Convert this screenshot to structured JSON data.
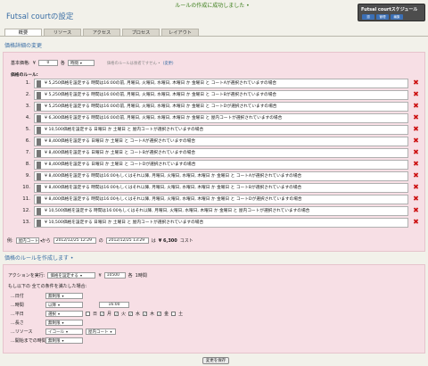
{
  "flash": "ルールの作成に成功しました •",
  "page_title": "Futsal courtの設定",
  "schedule": {
    "title": "Futsal courtスケジュール",
    "buttons": [
      {
        "label": "週",
        "color": "#3b6fb5"
      },
      {
        "label": "管理",
        "color": "#3b6fb5"
      },
      {
        "label": "編集",
        "color": "#3b6fb5"
      }
    ]
  },
  "tabs": [
    "概要",
    "リソース",
    "アクセス",
    "プロセス",
    "レイアウト"
  ],
  "pricing": {
    "section_title": "価格詳細の変更",
    "base_label": "基本価格:",
    "base_currency": "¥",
    "base_value": "0",
    "per_label": "各",
    "unit": "時間",
    "note": "価格のルールは後者ですせん • ",
    "note_link": "(変更)",
    "rules_label": "価格のルール:",
    "rules": [
      {
        "num": "1.",
        "text": "¥ 5,250価格を設定する 時間は16:00の前, 月曜日, 火曜日, 水曜日, 木曜日 か 金曜日 と コートAが選択されていますの場合"
      },
      {
        "num": "2.",
        "text": "¥ 5,250価格を設定する 時間は16:00の前, 月曜日, 火曜日, 水曜日, 木曜日 か 金曜日 と コートBが選択されていますの場合"
      },
      {
        "num": "3.",
        "text": "¥ 5,250価格を設定する 時間は16:00の前, 月曜日, 火曜日, 水曜日, 木曜日 か 金曜日 と コートDが選択されていますの場合"
      },
      {
        "num": "4.",
        "text": "¥ 6,300価格を設定する 時間は16:00の前, 月曜日, 火曜日, 水曜日, 木曜日 か 金曜日 と 屋内コートが選択されていますの場合"
      },
      {
        "num": "5.",
        "text": "¥ 10,500価格を設定する 日曜日 か 土曜日 と 屋内コートが選択されていますの場合"
      },
      {
        "num": "6.",
        "text": "¥ 8,400価格を設定する 日曜日 か 土曜日 と コートAが選択されていますの場合"
      },
      {
        "num": "7.",
        "text": "¥ 8,400価格を設定する 日曜日 か 土曜日 と コートBが選択されていますの場合"
      },
      {
        "num": "8.",
        "text": "¥ 8,400価格を設定する 日曜日 か 土曜日 と コートDが選択されていますの場合"
      },
      {
        "num": "9.",
        "text": "¥ 8,400価格を設定する 時間は16:00もしくはそれ以降, 月曜日, 火曜日, 水曜日, 木曜日 か 金曜日 と コートAが選択されていますの場合"
      },
      {
        "num": "10.",
        "text": "¥ 8,400価格を設定する 時間は16:00もしくはそれ以降, 月曜日, 火曜日, 水曜日, 木曜日 か 金曜日 と コートBが選択されていますの場合"
      },
      {
        "num": "11.",
        "text": "¥ 8,400価格を設定する 時間は16:00もしくはそれ以降, 月曜日, 火曜日, 水曜日, 木曜日 か 金曜日 と コートDが選択されていますの場合"
      },
      {
        "num": "12.",
        "text": "¥ 10,500価格を設定する 時間は16:00もしくはそれ以降, 月曜日, 火曜日, 水曜日, 木曜日 か 金曜日 と 屋内コートが選択されていますの場合"
      },
      {
        "num": "13.",
        "text": "¥ 10,500価格を設定する 日曜日 か 土曜日 と 屋内コートが選択されていますの場合"
      }
    ],
    "test": {
      "label": "例:",
      "resource": "屋内コート",
      "from": "から",
      "start": "2012/12/25 12:29",
      "to": "の",
      "end": "2012/12/25 13:29",
      "result_prefix": "は",
      "result": "¥ 6,300",
      "result_suffix": "コスト"
    }
  },
  "create": {
    "section_title": "価格のルールを作成します •",
    "action_label": "アクションを実行:",
    "action": "価格を設定する",
    "currency": "¥",
    "amount": "10500",
    "per": "各",
    "per_unit": "1時間",
    "cond_label": "もし以下の 全ての条件を満たした場合:",
    "rows": [
      {
        "label": "...日付",
        "op": "無制限"
      },
      {
        "label": "...時間",
        "op": "以降",
        "value": "16:00"
      },
      {
        "label": "...平日",
        "op": "選択"
      },
      {
        "label": "...長さ",
        "op": "無制限"
      },
      {
        "label": "...リソース",
        "op": "イコール",
        "value": "屋内コート"
      },
      {
        "label": "...開始までの時間",
        "op": "無制限"
      }
    ],
    "days": [
      {
        "label": "日",
        "checked": false
      },
      {
        "label": "月",
        "checked": true
      },
      {
        "label": "火",
        "checked": true
      },
      {
        "label": "水",
        "checked": true
      },
      {
        "label": "木",
        "checked": true
      },
      {
        "label": "金",
        "checked": true
      },
      {
        "label": "土",
        "checked": false
      }
    ]
  },
  "save_label": "変更を保存"
}
